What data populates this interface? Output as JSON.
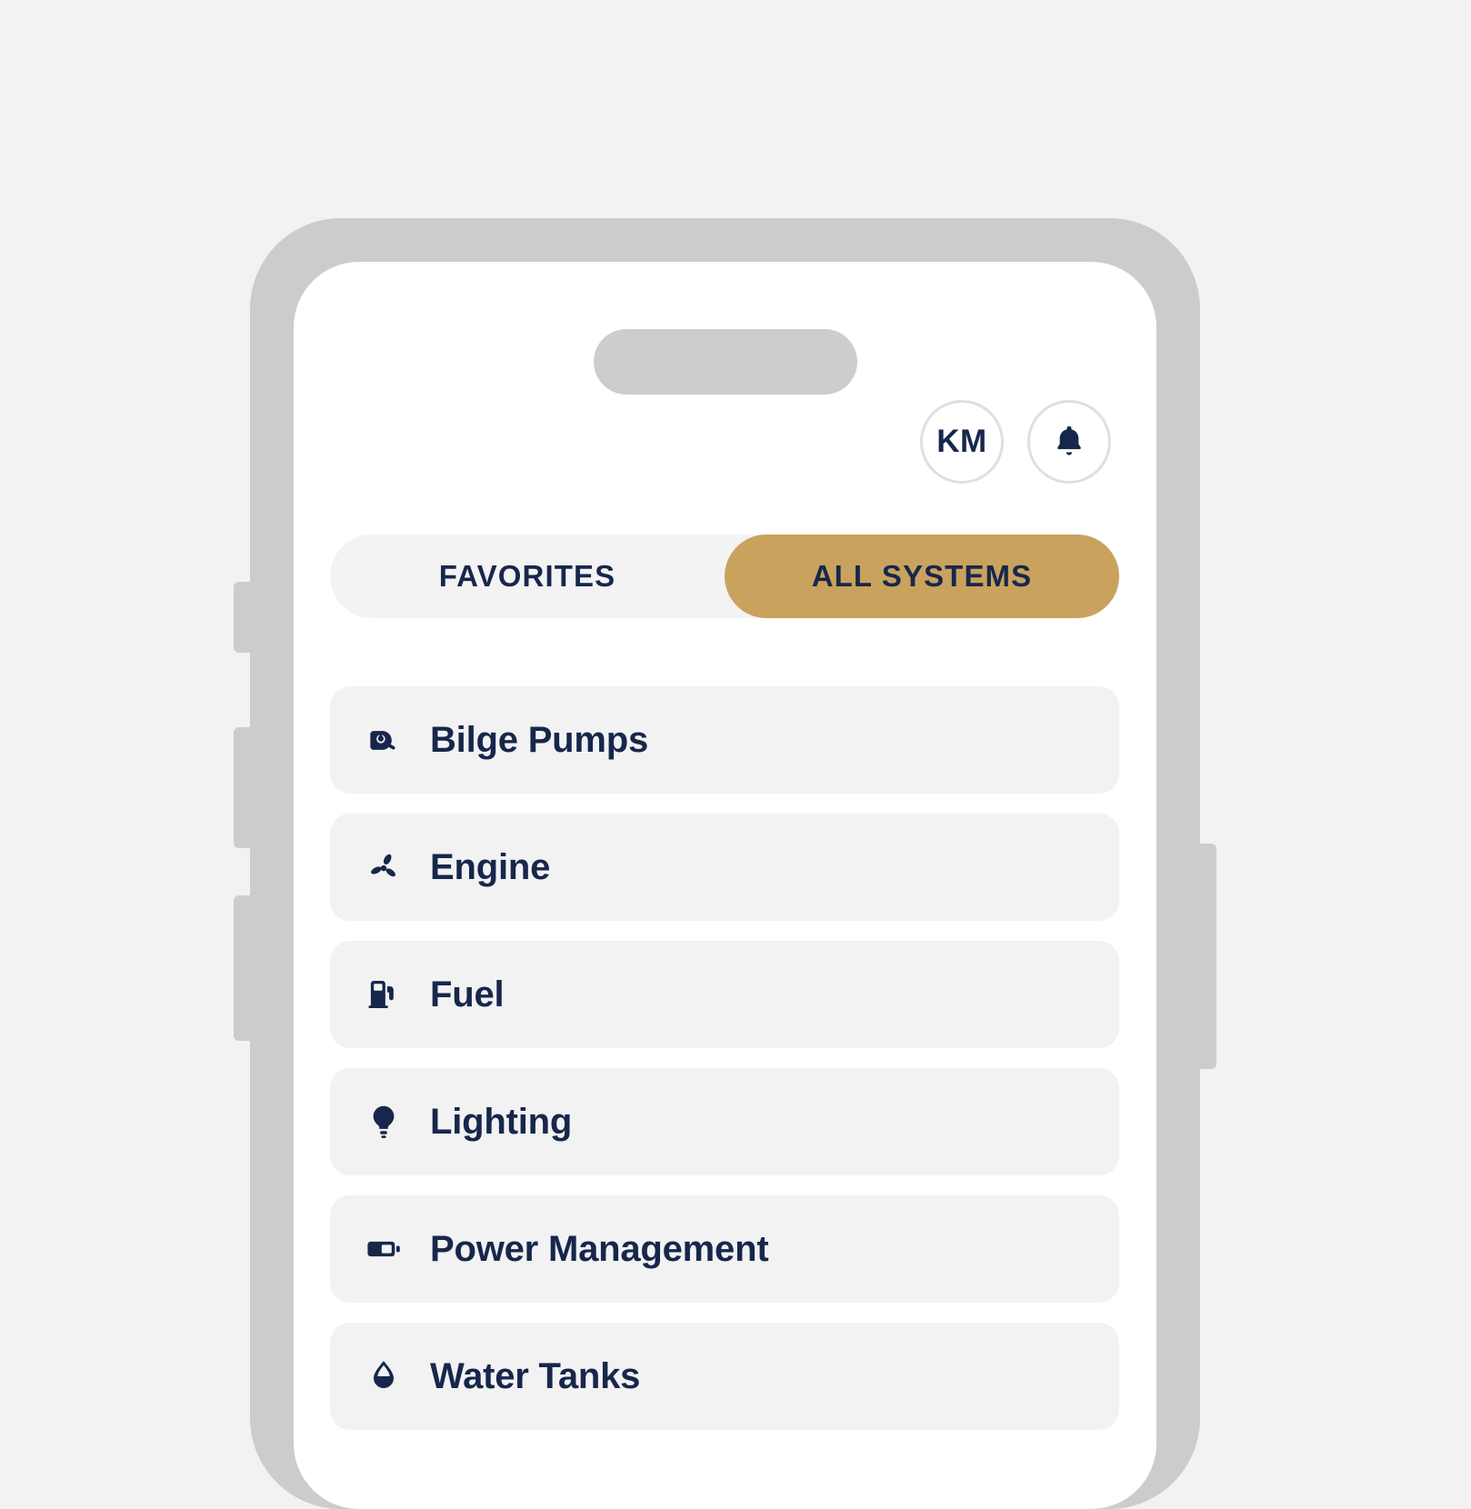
{
  "theme": {
    "page_background": "#f3f1f1",
    "frame_color": "#cccccc",
    "screen_background": "#ffffff",
    "accent_gold": "#c9a25e",
    "navy": "#17274b",
    "card_background": "#f2f2f3"
  },
  "top_bar": {
    "avatar_initials": "KM",
    "notification_icon": "bell-icon"
  },
  "tabs": [
    {
      "label": "FAVORITES",
      "active": false
    },
    {
      "label": "ALL SYSTEMS",
      "active": true
    }
  ],
  "systems": [
    {
      "label": "Bilge Pumps",
      "icon": "bilge-pump-icon"
    },
    {
      "label": "Engine",
      "icon": "propeller-icon"
    },
    {
      "label": "Fuel",
      "icon": "fuel-pump-icon"
    },
    {
      "label": "Lighting",
      "icon": "lightbulb-icon"
    },
    {
      "label": "Power Management",
      "icon": "battery-icon"
    },
    {
      "label": "Water Tanks",
      "icon": "water-drop-icon"
    }
  ],
  "hardware": {
    "mute_switch": "mute-switch-button",
    "volume_up": "volume-up-button",
    "volume_down": "volume-down-button",
    "power": "power-button",
    "dynamic_island": "dynamic-island"
  }
}
